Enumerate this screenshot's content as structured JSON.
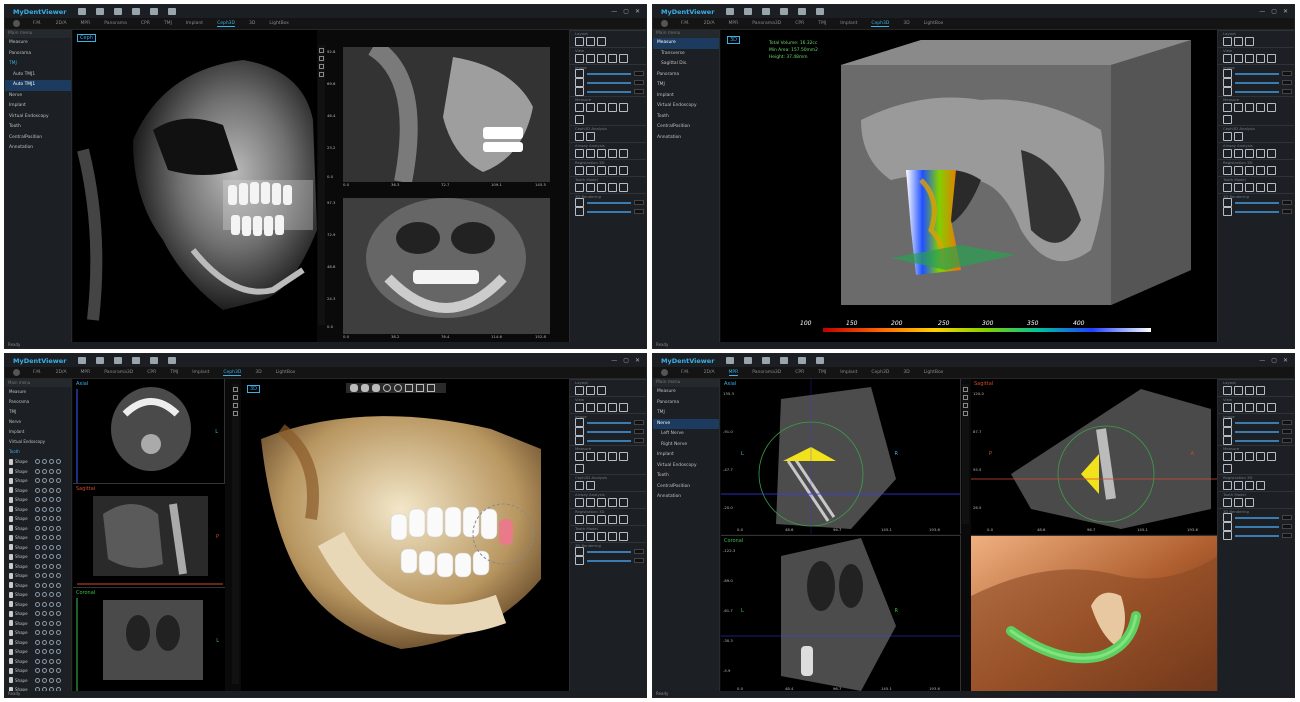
{
  "app": {
    "title": "MyDentViewer"
  },
  "window_controls": [
    "—",
    "▢",
    "✕"
  ],
  "q1": {
    "tabs": [
      "F.M.",
      "2D/A",
      "MPR",
      "Panorama",
      "CPR",
      "TMJ",
      "Implant",
      "Ceph3D",
      "3D",
      "LightBox"
    ],
    "active_tab": "Ceph3D",
    "left_header": "Main menu",
    "left_items": [
      "Measure",
      "Panorama",
      "TMJ",
      "Auto TMJ1",
      "Auto TMJ1",
      "Nerve",
      "Implant",
      "Virtual Endoscopy",
      "Tooth",
      "CentralPosition",
      "Annotation"
    ],
    "view_tag": "Ceph",
    "lat_x_ticks": [
      "0.0",
      "36.3",
      "72.7",
      "109.1",
      "145.5"
    ],
    "lat_y_ticks": [
      "92.8",
      "69.6",
      "46.4",
      "23.2",
      "0.0"
    ],
    "ap_x_ticks": [
      "0.0",
      "38.2",
      "76.4",
      "114.6",
      "152.8"
    ],
    "ap_y_ticks": [
      "97.3",
      "72.9",
      "48.6",
      "24.3",
      "0.0"
    ],
    "status": "Ready"
  },
  "q2": {
    "tabs": [
      "F.M.",
      "2D/A",
      "MPR",
      "Panorama3D",
      "CPR",
      "TMJ",
      "Implant",
      "Ceph3D",
      "3D",
      "LightBox"
    ],
    "active_tab": "Ceph3D",
    "left_items": [
      "Measure",
      "Transverse",
      "Sagittal Dis.",
      "Panorama",
      "TMJ",
      "Implant",
      "Virtual Endoscopy",
      "Tooth",
      "CentralPosition",
      "Annotation"
    ],
    "view_tag": "3D",
    "airway_info": [
      "Total Volume: 16.32cc",
      "Min Area: 157.50mm2",
      "Height: 37.48mm"
    ],
    "colorbar_labels": [
      "100",
      "150",
      "200",
      "250",
      "300",
      "350",
      "400"
    ],
    "status": "Ready"
  },
  "q3": {
    "tabs": [
      "F.M.",
      "2D/A",
      "MPR",
      "Panorama3D",
      "CPR",
      "TMJ",
      "Implant",
      "Ceph3D",
      "3D",
      "LightBox"
    ],
    "active_tab": "Ceph3D",
    "left_items": [
      "Measure",
      "Panorama",
      "TMJ",
      "Nerve",
      "Implant",
      "Virtual Endoscopy",
      "Tooth"
    ],
    "tooth_rows": [
      "Shape",
      "Shape",
      "Shape",
      "Shape",
      "Shape",
      "Shape",
      "Shape",
      "Shape",
      "Shape",
      "Shape",
      "Shape",
      "Shape",
      "Shape",
      "Shape",
      "Shape",
      "Shape",
      "Shape",
      "Shape",
      "Shape",
      "Shape",
      "Shape",
      "Shape",
      "Shape",
      "Shape",
      "Shape",
      "Shape",
      "Shape"
    ],
    "mpr_labels": [
      "Axial",
      "Sagittal",
      "Coronal"
    ],
    "orient": {
      "axial_r": "L",
      "sag_r": "P",
      "cor_r": "L"
    },
    "view_tag": "3D",
    "status": "Ready"
  },
  "q4": {
    "tabs": [
      "F.M.",
      "2D/A",
      "MPR",
      "Panorama3D",
      "CPR",
      "TMJ",
      "Implant",
      "Ceph3D",
      "3D",
      "LightBox"
    ],
    "active_tab": "MPR",
    "left_items": [
      "Measure",
      "Panorama",
      "TMJ",
      "Nerve",
      "Left Nerve",
      "Right Nerve",
      "Implant",
      "Virtual Endoscopy",
      "Tooth",
      "CentralPosition",
      "Annotation"
    ],
    "mpr_labels": [
      "Axial",
      "Sagittal",
      "Coronal"
    ],
    "orient": {
      "axial_l": "L",
      "axial_r": "R",
      "sag_l": "P",
      "sag_r": "A",
      "cor_l": "L",
      "cor_r": "R"
    },
    "axial_x_ticks": [
      "0.0",
      "48.6",
      "96.7",
      "145.1",
      "193.6"
    ],
    "axial_y_ticks": [
      "135.3",
      "-91.0",
      "-47.7",
      "-20.0"
    ],
    "sag_x_ticks": [
      "0.0",
      "48.6",
      "96.7",
      "145.1",
      "193.6"
    ],
    "sag_y_ticks": [
      "120.0",
      "87.7",
      "55.5",
      "26.5"
    ],
    "cor_x_ticks": [
      "0.0",
      "48.4",
      "96.7",
      "145.1",
      "193.6"
    ],
    "cor_y_ticks": [
      "-122.3",
      "-89.0",
      "-61.7",
      "-30.3",
      "-5.9"
    ],
    "status": "Ready"
  },
  "right_panel_sections": [
    "Layout",
    "View",
    "Image",
    "Measure",
    "Ceph3D Analysis",
    "Airway Analysis",
    "Registration 3D",
    "Tooth Model",
    "3D Rendering"
  ]
}
